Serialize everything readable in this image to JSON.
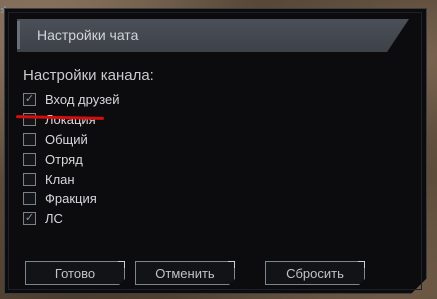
{
  "window": {
    "title": "Настройки чата"
  },
  "section": {
    "label": "Настройки канала:"
  },
  "options": [
    {
      "label": "Вход друзей",
      "checked": true
    },
    {
      "label": "Локация",
      "checked": false
    },
    {
      "label": "Общий",
      "checked": false
    },
    {
      "label": "Отряд",
      "checked": false
    },
    {
      "label": "Клан",
      "checked": false
    },
    {
      "label": "Фракция",
      "checked": false
    },
    {
      "label": "ЛС",
      "checked": true
    }
  ],
  "buttons": {
    "ok": "Готово",
    "cancel": "Отменить",
    "reset": "Сбросить"
  },
  "icons": {
    "corner": "gear-icon",
    "check": "checkmark-icon"
  },
  "colors": {
    "annotation_line": "#d40e0e"
  }
}
